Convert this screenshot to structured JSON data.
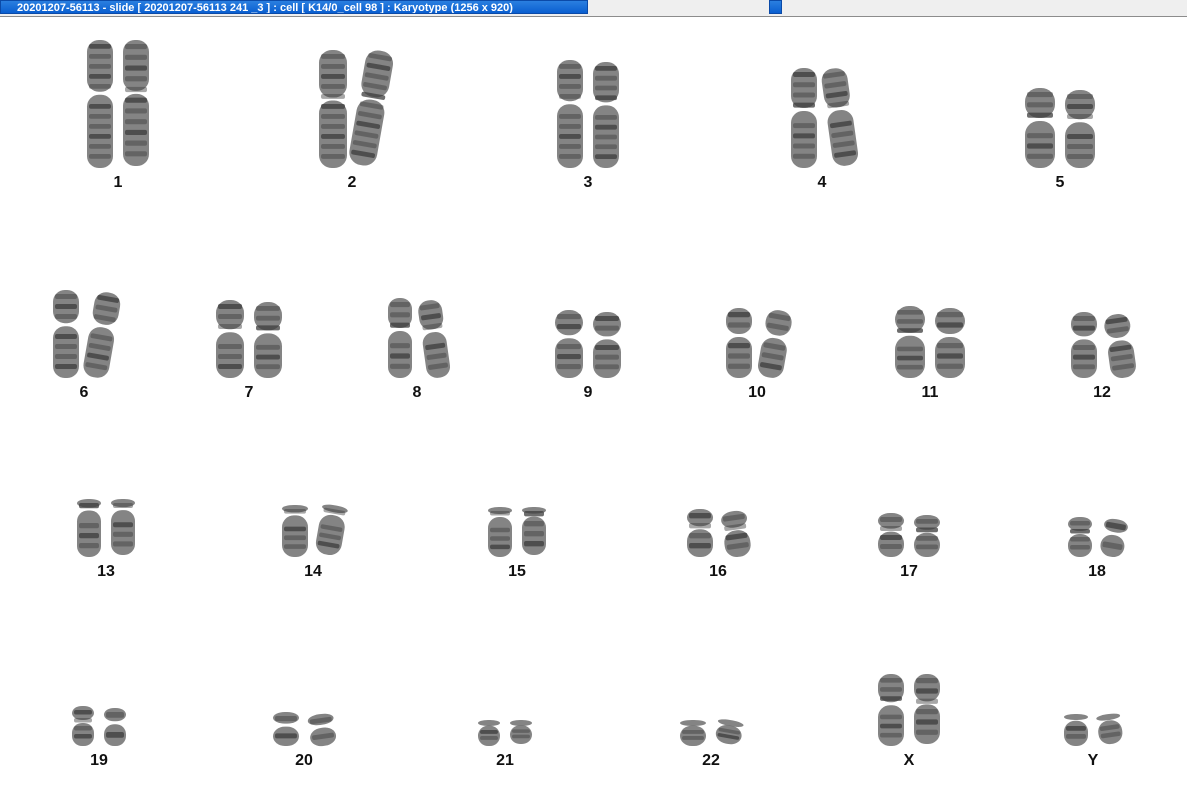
{
  "window": {
    "title": "20201207-56113 - slide [ 20201207-56113 241 _3 ] : cell [ K14/0_cell 98 ] : Karyotype  (1256 x 920)"
  },
  "karyotype": {
    "chromosomes": [
      {
        "label": "1"
      },
      {
        "label": "2"
      },
      {
        "label": "3"
      },
      {
        "label": "4"
      },
      {
        "label": "5"
      },
      {
        "label": "6"
      },
      {
        "label": "7"
      },
      {
        "label": "8"
      },
      {
        "label": "9"
      },
      {
        "label": "10"
      },
      {
        "label": "11"
      },
      {
        "label": "12"
      },
      {
        "label": "13"
      },
      {
        "label": "14"
      },
      {
        "label": "15"
      },
      {
        "label": "16"
      },
      {
        "label": "17"
      },
      {
        "label": "18"
      },
      {
        "label": "19"
      },
      {
        "label": "20"
      },
      {
        "label": "21"
      },
      {
        "label": "22"
      },
      {
        "label": "X"
      },
      {
        "label": "Y"
      }
    ],
    "colors": {
      "chromatin": "#6e6e6e",
      "band": "#3c3c3c",
      "background": "#ffffff"
    }
  }
}
